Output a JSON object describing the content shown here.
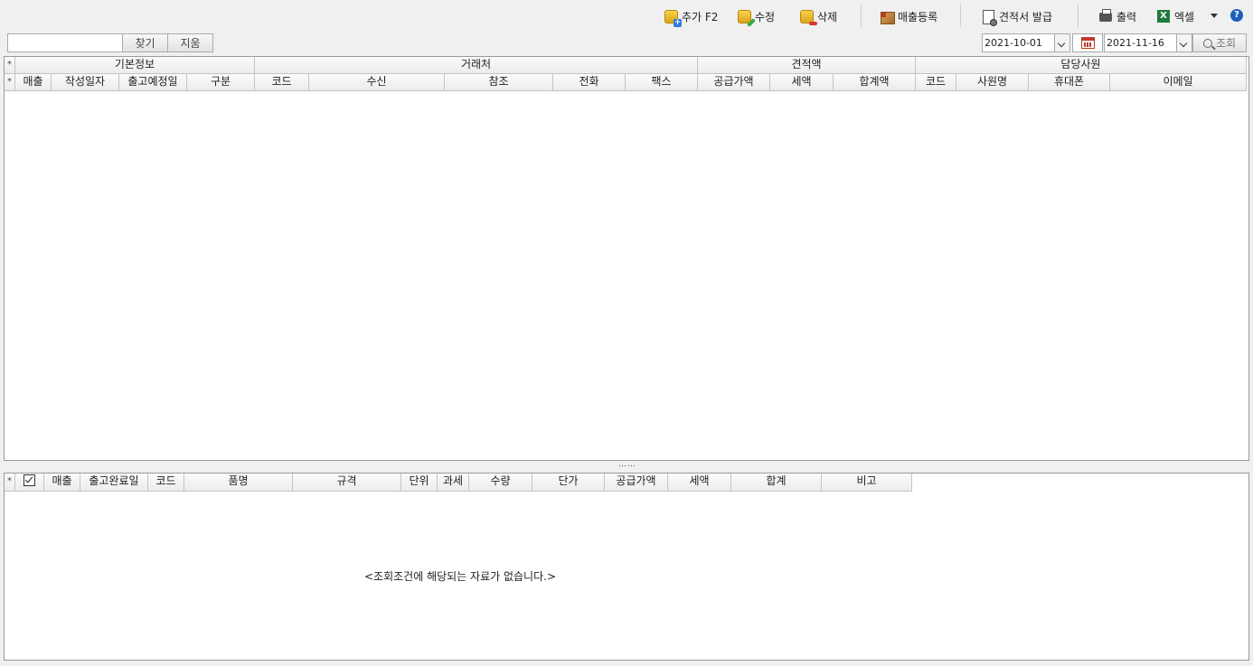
{
  "toolbar": {
    "add_label": "추가 F2",
    "edit_label": "수정",
    "delete_label": "삭제",
    "sales_register_label": "매출등록",
    "quote_issue_label": "견적서 발급",
    "print_label": "출력",
    "excel_label": "엑셀",
    "excel_icon_text": "X",
    "help_icon_text": "?"
  },
  "search": {
    "value": "",
    "find_label": "찾기",
    "clear_label": "지움",
    "date_from": "2021-10-01",
    "date_to": "2021-11-16",
    "query_label": "조회"
  },
  "main_grid": {
    "star": "*",
    "groups": [
      "기본정보",
      "거래처",
      "견적액",
      "담당사원"
    ],
    "columns": [
      "매출",
      "작성일자",
      "출고예정일",
      "구분",
      "코드",
      "수신",
      "참조",
      "전화",
      "팩스",
      "공급가액",
      "세액",
      "합계액",
      "코드",
      "사원명",
      "휴대폰",
      "이메일"
    ]
  },
  "splitter_text": "……",
  "detail_grid": {
    "star": "*",
    "columns": [
      "매출",
      "출고완료일",
      "코드",
      "품명",
      "규격",
      "단위",
      "과세",
      "수량",
      "단가",
      "공급가액",
      "세액",
      "합계",
      "비고"
    ],
    "empty_message": "<조회조건에 해당되는 자료가 없습니다.>"
  },
  "colors": {
    "background": "#f0f0f0",
    "grid_border": "#9a9a9a",
    "header_bg": "#ececec",
    "help_blue": "#1b5fb8",
    "excel_green": "#1f7a3f"
  }
}
